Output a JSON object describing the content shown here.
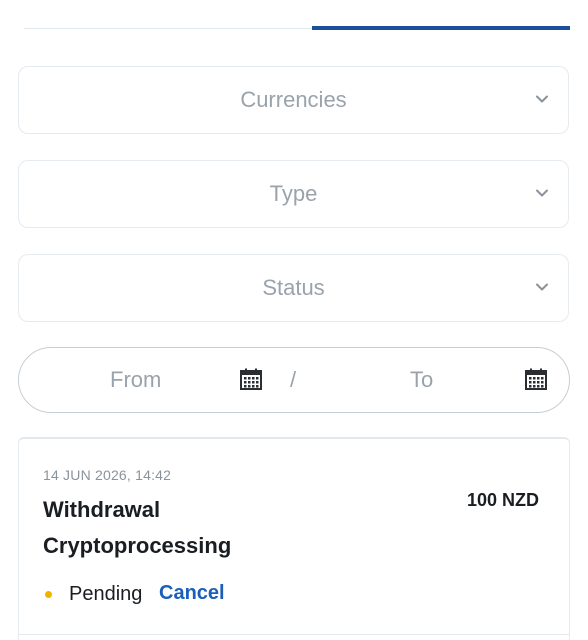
{
  "filters": {
    "currencies_label": "Currencies",
    "type_label": "Type",
    "status_label": "Status"
  },
  "date_range": {
    "from_label": "From",
    "to_label": "To",
    "separator": "/"
  },
  "transaction": {
    "date": "14 JUN 2026, 14:42",
    "title_line1": "Withdrawal",
    "title_line2": "Cryptoprocessing",
    "amount": "100 NZD",
    "status": "Pending",
    "status_color": "#f0b400",
    "cancel_label": "Cancel"
  },
  "icons": {
    "chevron": "chevron-down-icon",
    "calendar": "calendar-icon"
  },
  "colors": {
    "accent": "#1b4f9c",
    "link": "#1b5fb8",
    "placeholder": "#9aa3ab"
  }
}
